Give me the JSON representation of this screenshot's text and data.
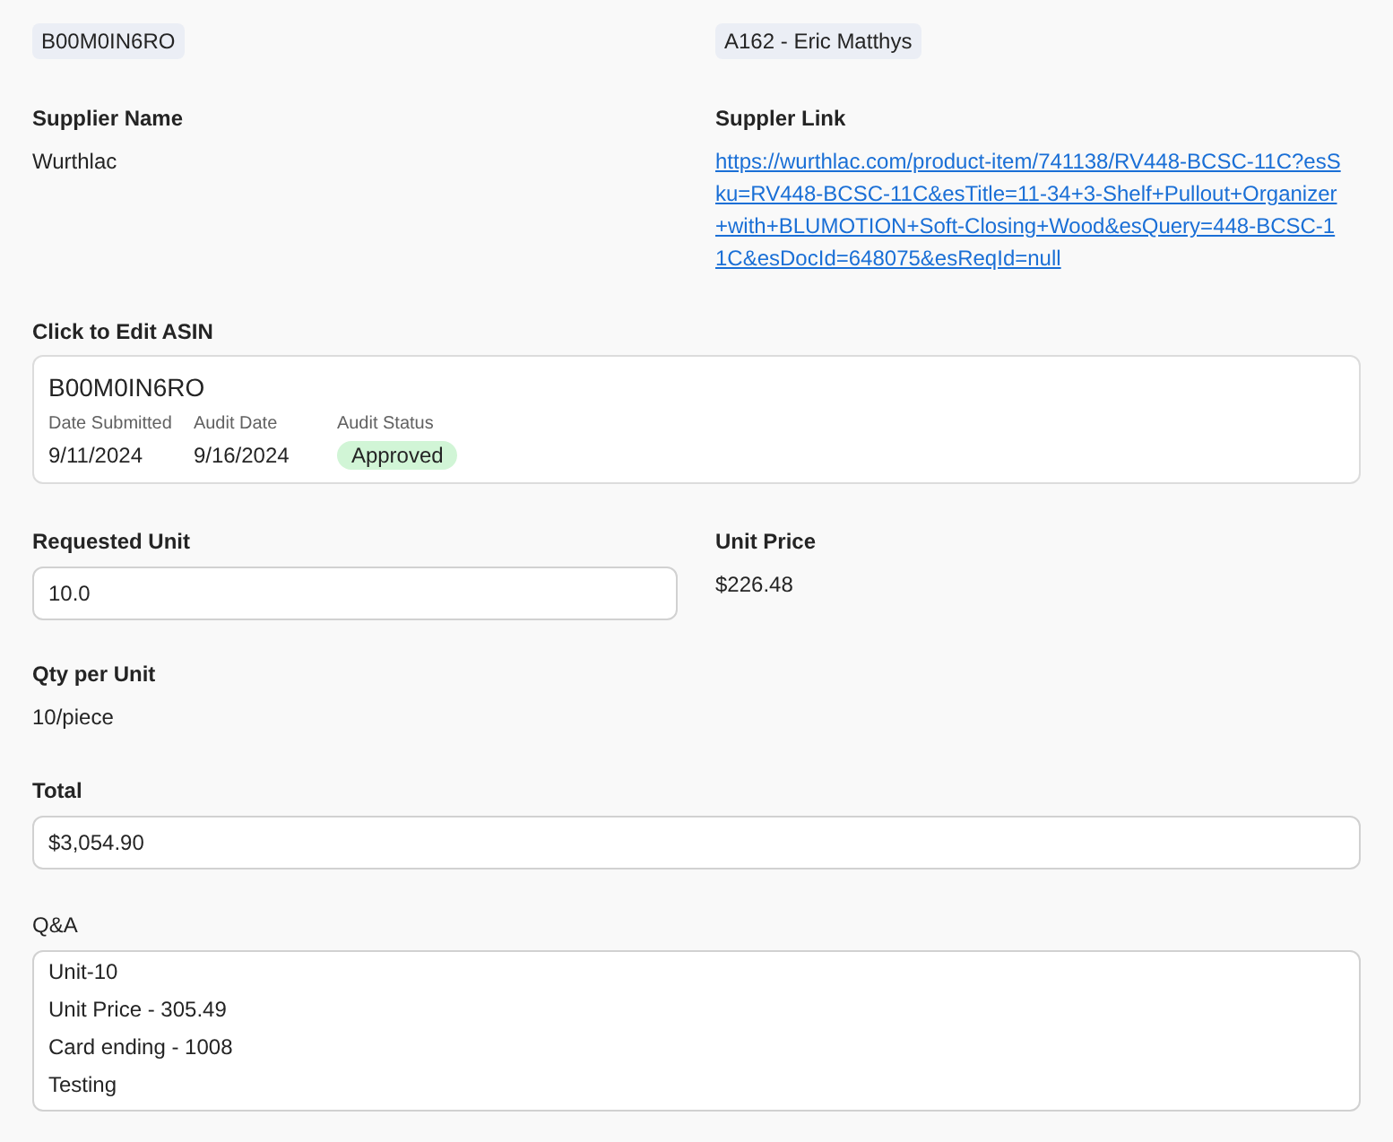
{
  "top_chips": [
    {
      "value": "B00M0IN6RO"
    },
    {
      "value": "A162 - Eric Matthys"
    }
  ],
  "supplier": {
    "name_label": "Supplier Name",
    "name": "Wurthlac",
    "link_label": "Suppler Link",
    "link": "https://wurthlac.com/product-item/741138/RV448-BCSC-11C?esSku=RV448-BCSC-11C&esTitle=11-34+3-Shelf+Pullout+Organizer+with+BLUMOTION+Soft-Closing+Wood&esQuery=448-BCSC-11C&esDocId=648075&esReqId=null"
  },
  "asin_card": {
    "label": "Click to Edit ASIN",
    "asin": "B00M0IN6RO",
    "fields": [
      {
        "kind": "text",
        "label": "Date Submitted",
        "value": "9/11/2024"
      },
      {
        "kind": "text",
        "label": "Audit Date",
        "value": "9/16/2024"
      },
      {
        "kind": "badge",
        "label": "Audit Status",
        "value": "Approved",
        "color": "#d1f5d6"
      }
    ]
  },
  "requested_unit": {
    "label": "Requested Unit",
    "value": "10.0"
  },
  "unit_price": {
    "label": "Unit Price",
    "value": "$226.48"
  },
  "qty_per_unit": {
    "label": "Qty per Unit",
    "value": "10/piece"
  },
  "total": {
    "label": "Total",
    "value": "$3,054.90"
  },
  "qa": {
    "label": "Q&A",
    "lines": [
      "Unit-10",
      "Unit Price - 305.49",
      "Card ending - 1008",
      "Testing"
    ]
  }
}
